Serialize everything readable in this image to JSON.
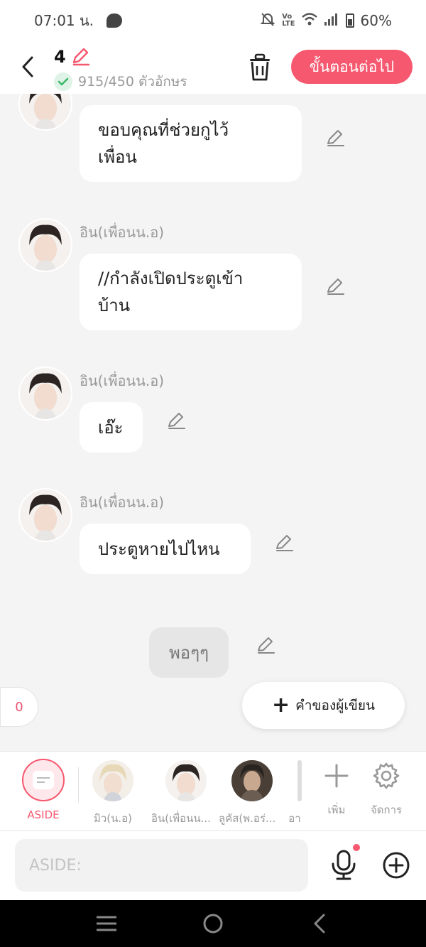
{
  "status": {
    "time": "07:01 น.",
    "battery": "60%",
    "icons": [
      "chat-bubble-icon",
      "mute-icon",
      "volte-icon",
      "wifi-icon",
      "signal-icon",
      "battery-icon"
    ]
  },
  "header": {
    "episode_number": "4",
    "char_count": "915/450 ตัวอักษร",
    "next_label": "ขั้นตอนต่อไป"
  },
  "messages": [
    {
      "sender": "",
      "text": [
        "ขอบคุณที่ช่วยกูไว้",
        "เพื่อน"
      ]
    },
    {
      "sender": "อิน(เพื่อนน.อ)",
      "text": [
        "//กำลังเปิดประตูเข้า",
        "บ้าน"
      ]
    },
    {
      "sender": "อิน(เพื่อนน.อ)",
      "text": [
        "เอ๊ะ"
      ]
    },
    {
      "sender": "อิน(เพื่อนน.อ)",
      "text": [
        "ประตูหายไปไหน"
      ]
    },
    {
      "sender": "",
      "text": [
        "พอๆๆ"
      ]
    }
  ],
  "float": {
    "counter": "0",
    "writer_note_label": "คำของผู้เขียน"
  },
  "characters": [
    {
      "label": "ASIDE"
    },
    {
      "label": "มิว(น.อ)"
    },
    {
      "label": "อิน(เพื่อนน..."
    },
    {
      "label": "ลูคัส(พ.อร่..."
    },
    {
      "label": "อา"
    }
  ],
  "tools": {
    "add_label": "เพิ่ม",
    "manage_label": "จัดการ"
  },
  "input": {
    "placeholder": "ASIDE:"
  },
  "colors": {
    "accent": "#f6586f",
    "check": "#3dba6c"
  }
}
